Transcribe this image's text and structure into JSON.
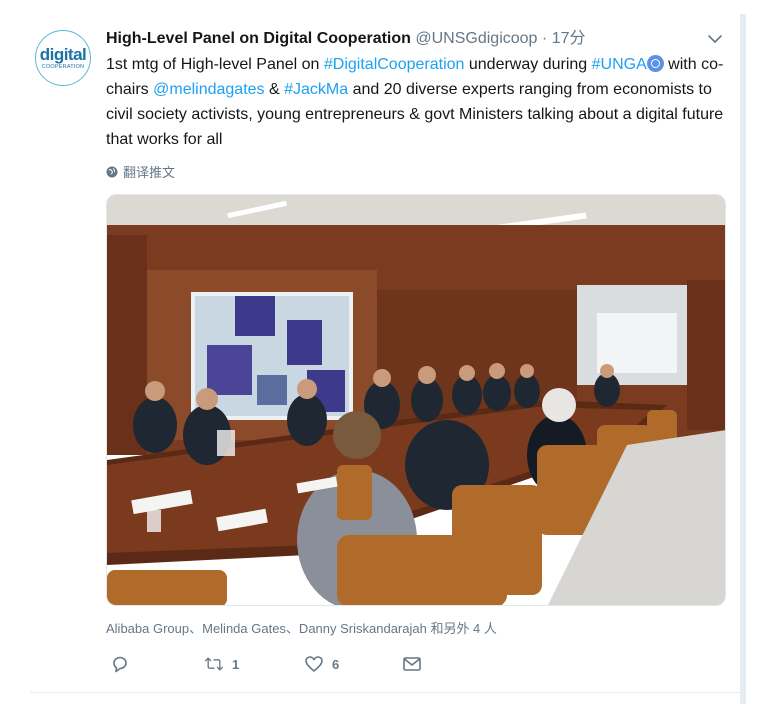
{
  "author": {
    "name": "High-Level Panel on Digital Cooperation",
    "handle": "@UNSGdigicoop",
    "separator": "·",
    "time": "17分",
    "avatar_logo": "digital",
    "avatar_sub": "COOPERATION"
  },
  "tweet": {
    "t1": "1st mtg of High-level Panel on ",
    "l1": "#DigitalCooperation",
    "t2": " underway during ",
    "l2": "#UNGA",
    "t3": " with co-chairs ",
    "l3": "@melindagates",
    "t4": " & ",
    "l4": "#JackMa",
    "t5": " and 20 diverse experts ranging from economists to civil society activists, young entrepreneurs & govt Ministers talking about a digital future that works for all"
  },
  "translate_label": "翻译推文",
  "tagged_people": "Alibaba Group、Melinda Gates、Danny Sriskandarajah 和另外 4 人",
  "actions": {
    "reply_count": "",
    "retweet_count": "1",
    "like_count": "6"
  },
  "icons": {
    "more": "chevron-down-icon",
    "translate": "globe-icon",
    "reply": "reply-icon",
    "retweet": "retweet-icon",
    "like": "heart-icon",
    "dm": "envelope-icon"
  },
  "colors": {
    "link": "#1da1f2",
    "secondary_text": "#657786",
    "primary_text": "#14171a"
  }
}
